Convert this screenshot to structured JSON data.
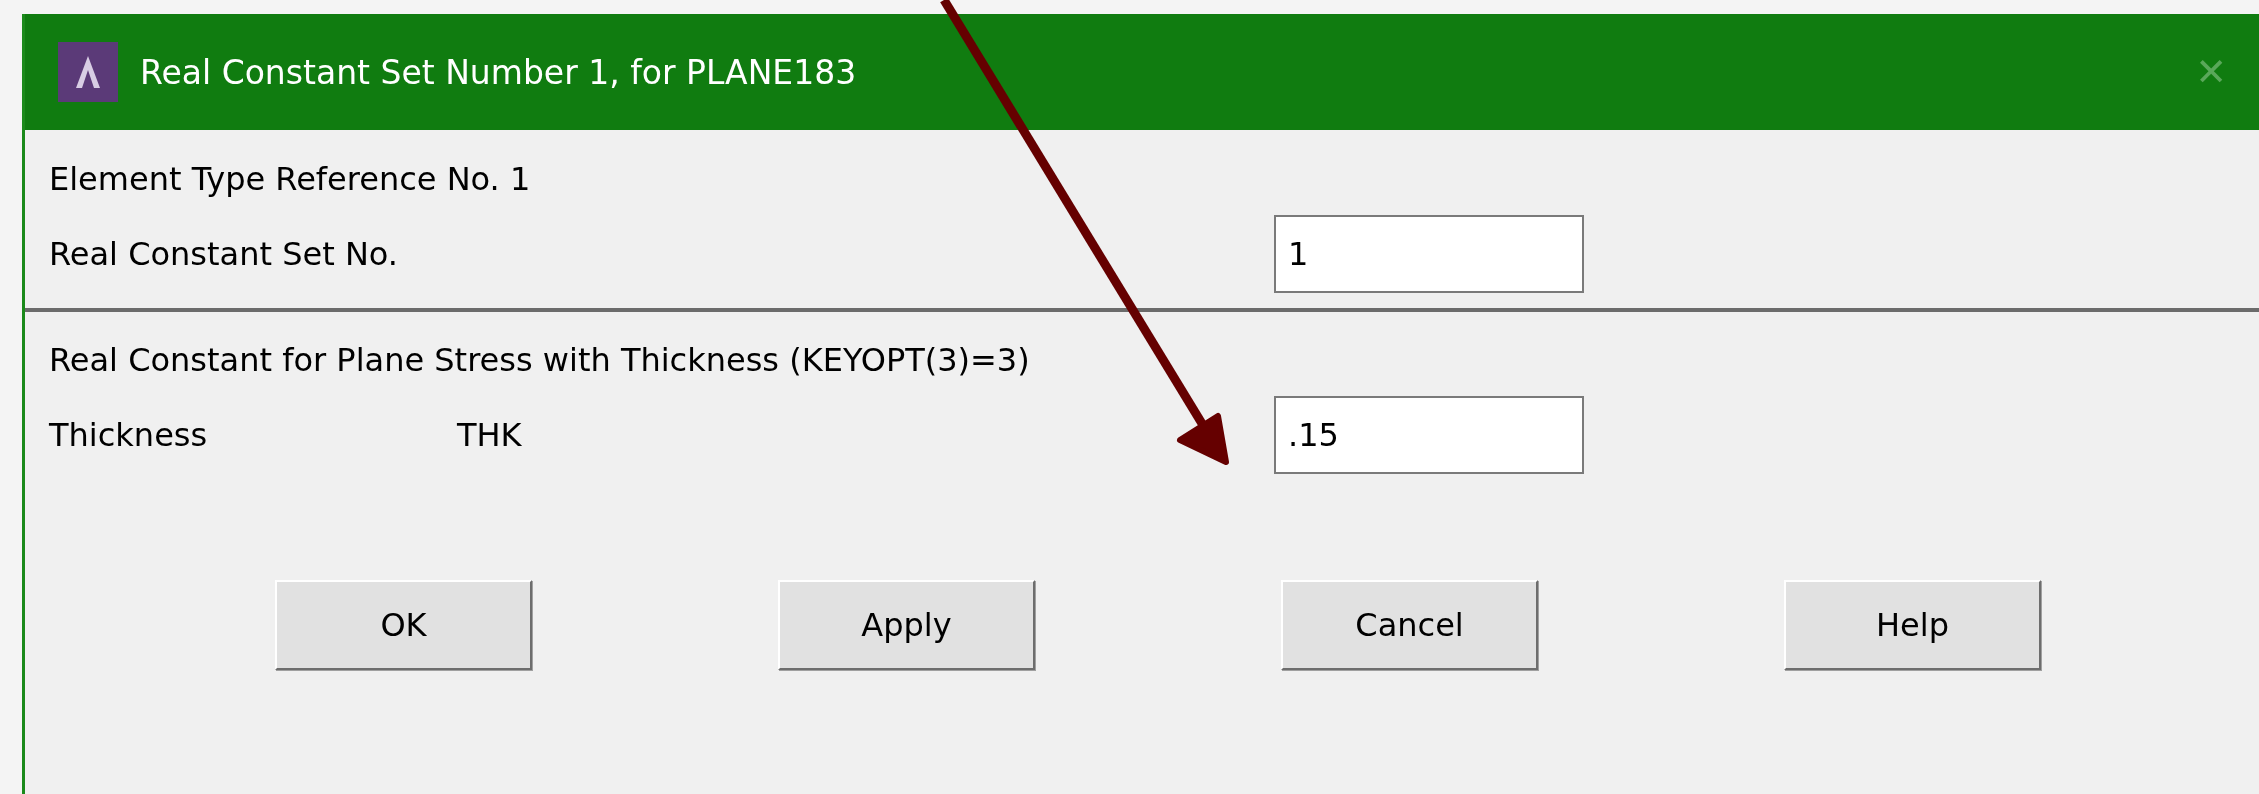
{
  "window": {
    "title": "Real Constant Set Number 1, for PLANE183",
    "close": "✕"
  },
  "header": {
    "element_type": "Element Type Reference No. 1",
    "set_label": "Real Constant Set No.",
    "set_value": "1"
  },
  "section": {
    "title": "Real Constant for Plane Stress with Thickness (KEYOPT(3)=3)",
    "rows": [
      {
        "label": "Thickness",
        "symbol": "THK",
        "value": ".15"
      }
    ]
  },
  "buttons": [
    "OK",
    "Apply",
    "Cancel",
    "Help"
  ]
}
